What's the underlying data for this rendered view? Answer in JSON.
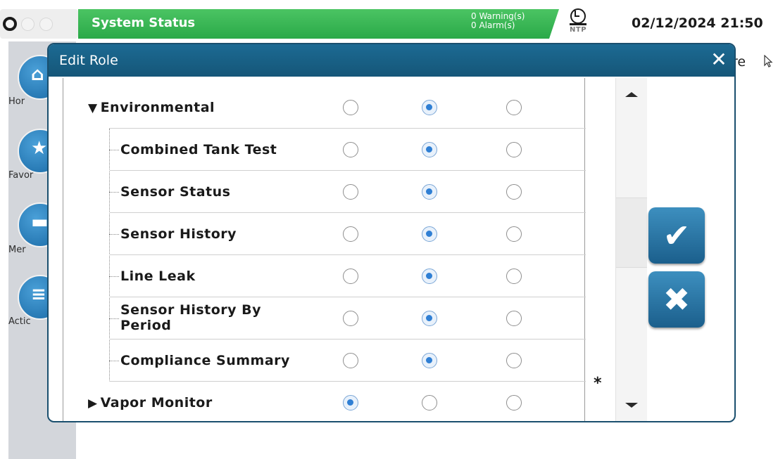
{
  "topbar": {
    "title": "System Status",
    "warnings": "0 Warning(s)",
    "alarms": "0 Alarm(s)",
    "ntp_label": "NTP",
    "datetime": "02/12/2024 21:50"
  },
  "leftnav": {
    "items": [
      {
        "label": "Hor",
        "icon": "home-icon"
      },
      {
        "label": "Favor",
        "icon": "star-icon"
      },
      {
        "label": "Mer",
        "icon": "menu-icon"
      },
      {
        "label": "Actic",
        "icon": "actions-icon"
      }
    ]
  },
  "background_fragment": "re",
  "dialog": {
    "title": "Edit Role",
    "close_glyph": "✕",
    "rows": [
      {
        "label": "Environmental",
        "type": "parent-expanded",
        "selected": 2
      },
      {
        "label": "Combined Tank Test",
        "type": "child",
        "selected": 2
      },
      {
        "label": "Sensor Status",
        "type": "child",
        "selected": 2
      },
      {
        "label": "Sensor History",
        "type": "child",
        "selected": 2
      },
      {
        "label": "Line Leak",
        "type": "child",
        "selected": 2
      },
      {
        "label": "Sensor History By Period",
        "type": "child",
        "selected": 2
      },
      {
        "label": "Compliance Summary",
        "type": "child",
        "selected": 2
      },
      {
        "label": "Vapor Monitor",
        "type": "parent-collapsed",
        "selected": 1
      }
    ],
    "asterisk": "*",
    "ok_icon": "check-icon",
    "cancel_icon": "x-icon"
  }
}
